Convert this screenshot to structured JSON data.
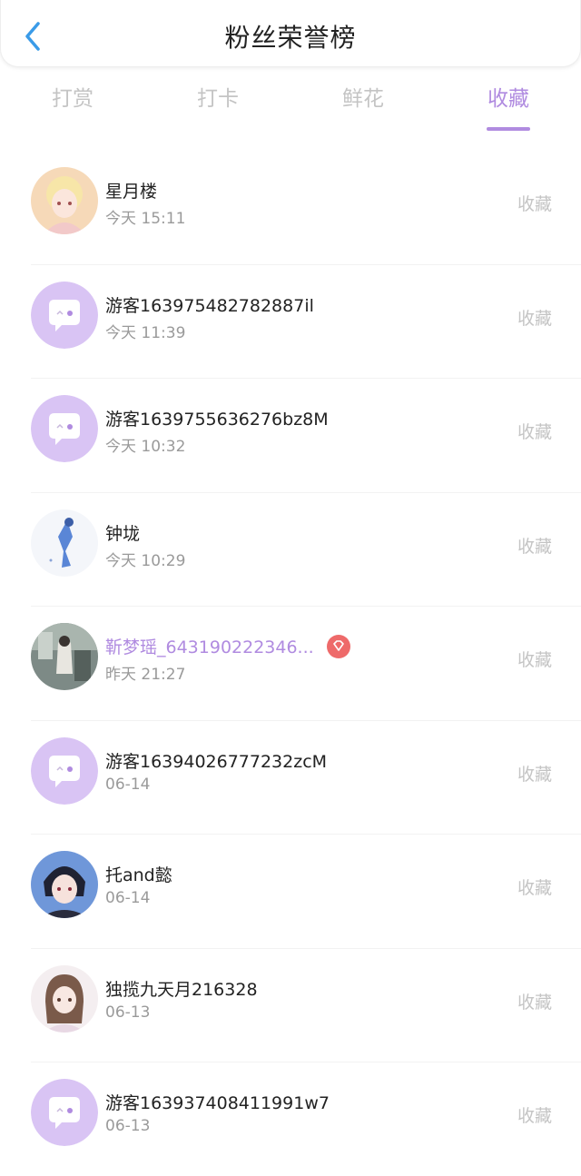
{
  "header": {
    "title": "粉丝荣誉榜"
  },
  "tabs": [
    {
      "label": "打赏"
    },
    {
      "label": "打卡"
    },
    {
      "label": "鲜花"
    },
    {
      "label": "收藏"
    }
  ],
  "rows": [
    {
      "name": "星月楼",
      "time": "今天 15:11",
      "action": "收藏",
      "avatar": "anime-girl-blonde"
    },
    {
      "name": "游客163975482782887il",
      "time": "今天 11:39",
      "action": "收藏",
      "avatar": "default-chat"
    },
    {
      "name": "游客1639755636276bz8M",
      "time": "今天 10:32",
      "action": "收藏",
      "avatar": "default-chat"
    },
    {
      "name": "钟垅",
      "time": "今天 10:29",
      "action": "收藏",
      "avatar": "blue-figure"
    },
    {
      "name": "靳梦瑶_643190222346...",
      "time": "昨天 21:27",
      "action": "收藏",
      "avatar": "photo-room"
    },
    {
      "name": "游客16394026777232zcM",
      "time": "06-14",
      "action": "收藏",
      "avatar": "default-chat"
    },
    {
      "name": "托and懿",
      "time": "06-14",
      "action": "收藏",
      "avatar": "anime-boy"
    },
    {
      "name": "独揽九天月216328",
      "time": "06-13",
      "action": "收藏",
      "avatar": "anime-girl-pink"
    },
    {
      "name": "游客163937408411991w7",
      "time": "06-13",
      "action": "收藏",
      "avatar": "default-chat"
    }
  ],
  "colors": {
    "accent": "#b08be0",
    "muted": "#c4c4c4",
    "badge": "#ee6a6a",
    "back": "#3a9be8"
  }
}
